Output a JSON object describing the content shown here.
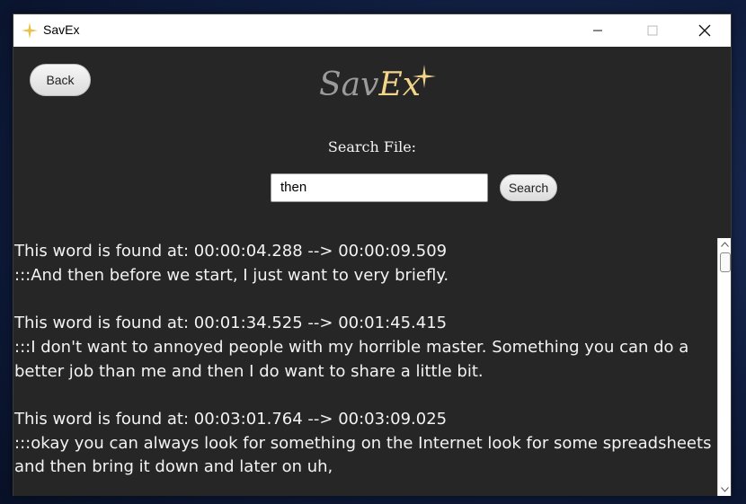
{
  "window": {
    "title": "SavEx"
  },
  "header": {
    "back_label": "Back",
    "logo_part1": "Sav",
    "logo_part2": "Ex"
  },
  "search": {
    "label": "Search File:",
    "value": "then",
    "button_label": "Search"
  },
  "results": [
    {
      "timestamp_line": "This word is found at: 00:00:04.288 --> 00:00:09.509",
      "text": ":::And then before we start, I just want to very briefly."
    },
    {
      "timestamp_line": "This word is found at: 00:01:34.525 --> 00:01:45.415",
      "text": ":::I don't want to annoyed people with my horrible master. Something you can do a better job than me and then I do want to share a little bit."
    },
    {
      "timestamp_line": "This word is found at: 00:03:01.764 --> 00:03:09.025",
      "text": ":::okay you can always look for something on the Internet look for some spreadsheets and then bring it down and later on uh,"
    }
  ],
  "colors": {
    "content_bg": "#262626",
    "logo_gray": "#9b9b9b",
    "logo_gold": "#f2d48a"
  }
}
